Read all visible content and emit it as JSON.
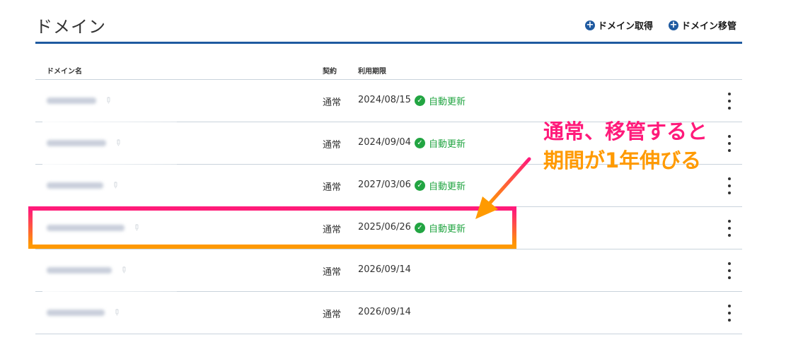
{
  "header": {
    "title": "ドメイン",
    "acquire_label": "ドメイン取得",
    "transfer_label": "ドメイン移管"
  },
  "table": {
    "columns": [
      "ドメイン名",
      "契約",
      "利用期限"
    ],
    "rows": [
      {
        "contract": "通常",
        "expiry": "2024/08/15",
        "auto_renew": "自動更新"
      },
      {
        "contract": "通常",
        "expiry": "2024/09/04",
        "auto_renew": "自動更新"
      },
      {
        "contract": "通常",
        "expiry": "2027/03/06",
        "auto_renew": "自動更新"
      },
      {
        "contract": "通常",
        "expiry": "2025/06/26",
        "auto_renew": "自動更新"
      },
      {
        "contract": "通常",
        "expiry": "2026/09/14",
        "auto_renew": ""
      },
      {
        "contract": "通常",
        "expiry": "2026/09/14",
        "auto_renew": ""
      }
    ]
  },
  "annotation": {
    "line1": "通常、移管すると",
    "line2": "期間が1年伸びる"
  },
  "colors": {
    "accent": "#1f5aa0",
    "renew_green": "#22a542",
    "highlight_pink": "#ff1a7a",
    "highlight_orange": "#ff9a00"
  }
}
